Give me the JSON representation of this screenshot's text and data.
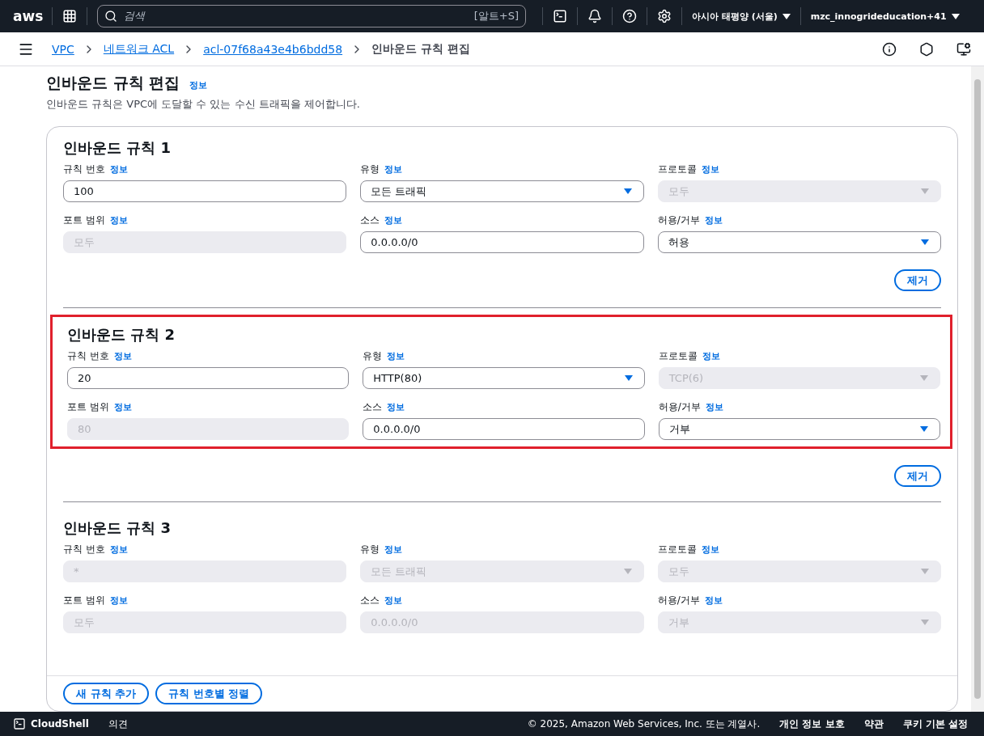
{
  "topnav": {
    "logo": "aws",
    "search_placeholder": "검색",
    "shortcut": "[알트+S]",
    "region": "아시아 태평양 (서울)",
    "account": "mzc_innogrideducation+41"
  },
  "breadcrumbs": [
    {
      "label": "VPC",
      "link": true
    },
    {
      "label": "네트워크 ACL",
      "link": true
    },
    {
      "label": "acl-07f68a43e4b6bdd58",
      "link": true
    },
    {
      "label": "인바운드 규칙 편집",
      "link": false
    }
  ],
  "header": {
    "title": "인바운드 규칙 편집",
    "info": "정보",
    "description": "인바운드 규칙은 VPC에 도달할 수 있는 수신 트래픽을 제어합니다."
  },
  "rules": [
    {
      "title": "인바운드 규칙 1",
      "highlighted": false,
      "remove": "제거",
      "fields": [
        {
          "label": "규칙 번호",
          "info": "정보",
          "kind": "input",
          "value": "100",
          "disabled": false
        },
        {
          "label": "유형",
          "info": "정보",
          "kind": "select",
          "value": "모든 트래픽",
          "disabled": false
        },
        {
          "label": "프로토콜",
          "info": "정보",
          "kind": "select",
          "value": "모두",
          "disabled": true
        },
        {
          "label": "포트 범위",
          "info": "정보",
          "kind": "input",
          "value": "모두",
          "disabled": true
        },
        {
          "label": "소스",
          "info": "정보",
          "kind": "input",
          "value": "0.0.0.0/0",
          "disabled": false
        },
        {
          "label": "허용/거부",
          "info": "정보",
          "kind": "select",
          "value": "허용",
          "disabled": false
        }
      ]
    },
    {
      "title": "인바운드 규칙 2",
      "highlighted": true,
      "remove": "제거",
      "fields": [
        {
          "label": "규칙 번호",
          "info": "정보",
          "kind": "input",
          "value": "20",
          "disabled": false
        },
        {
          "label": "유형",
          "info": "정보",
          "kind": "select",
          "value": "HTTP(80)",
          "disabled": false
        },
        {
          "label": "프로토콜",
          "info": "정보",
          "kind": "select",
          "value": "TCP(6)",
          "disabled": true
        },
        {
          "label": "포트 범위",
          "info": "정보",
          "kind": "input",
          "value": "80",
          "disabled": true
        },
        {
          "label": "소스",
          "info": "정보",
          "kind": "input",
          "value": "0.0.0.0/0",
          "disabled": false
        },
        {
          "label": "허용/거부",
          "info": "정보",
          "kind": "select",
          "value": "거부",
          "disabled": false
        }
      ]
    },
    {
      "title": "인바운드 규칙 3",
      "highlighted": false,
      "fields": [
        {
          "label": "규칙 번호",
          "info": "정보",
          "kind": "input",
          "value": "*",
          "disabled": true
        },
        {
          "label": "유형",
          "info": "정보",
          "kind": "select",
          "value": "모든 트래픽",
          "disabled": true
        },
        {
          "label": "프로토콜",
          "info": "정보",
          "kind": "select",
          "value": "모두",
          "disabled": true
        },
        {
          "label": "포트 범위",
          "info": "정보",
          "kind": "input",
          "value": "모두",
          "disabled": true
        },
        {
          "label": "소스",
          "info": "정보",
          "kind": "input",
          "value": "0.0.0.0/0",
          "disabled": true
        },
        {
          "label": "허용/거부",
          "info": "정보",
          "kind": "select",
          "value": "거부",
          "disabled": true
        }
      ]
    }
  ],
  "actions": [
    "새 규칙 추가",
    "규칙 번호별 정렬"
  ],
  "footer": {
    "cloudshell": "CloudShell",
    "feedback": "의견",
    "copyright": "© 2025, Amazon Web Services, Inc. 또는 계열사.",
    "links": [
      "개인 정보 보호",
      "약관",
      "쿠키 기본 설정"
    ]
  }
}
